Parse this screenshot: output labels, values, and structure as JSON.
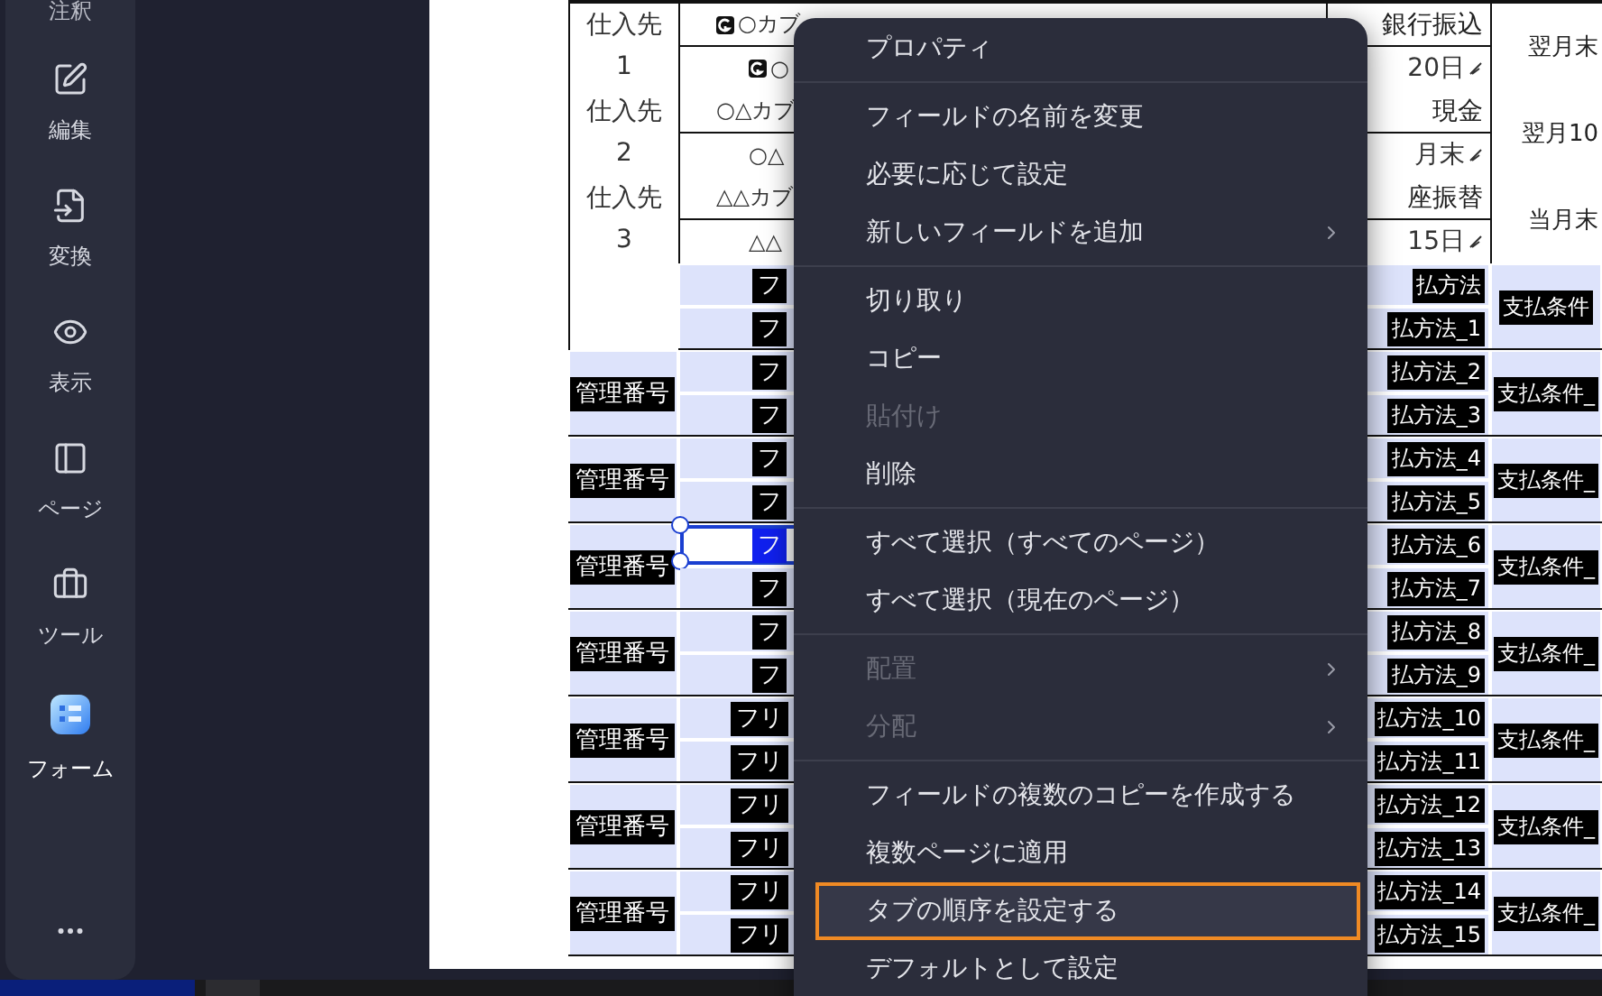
{
  "sidebar": {
    "items": [
      {
        "label": "注釈",
        "kind": "annotate",
        "selected": false
      },
      {
        "label": "編集",
        "kind": "edit",
        "selected": false
      },
      {
        "label": "変換",
        "kind": "convert",
        "selected": false
      },
      {
        "label": "表示",
        "kind": "view",
        "selected": false
      },
      {
        "label": "ページ",
        "kind": "page",
        "selected": false
      },
      {
        "label": "ツール",
        "kind": "tools",
        "selected": false
      },
      {
        "label": "フォーム",
        "kind": "form",
        "selected": true
      }
    ]
  },
  "document": {
    "suppliers": [
      {
        "label": "仕入先",
        "number": "1",
        "names": [
          {
            "text": "○カブ",
            "marked": true
          },
          {
            "text": "○",
            "marked": true
          }
        ],
        "method": "銀行振込",
        "date": "20日",
        "terms": "翌月末"
      },
      {
        "label": "仕入先",
        "number": "2",
        "names": [
          {
            "text": "○△カブ",
            "marked": false
          },
          {
            "text": "○△",
            "marked": false
          }
        ],
        "method": "現金",
        "date": "月末",
        "terms": "翌月10"
      },
      {
        "label": "仕入先",
        "number": "3",
        "names": [
          {
            "text": "△△カブ",
            "marked": false
          },
          {
            "text": "△△",
            "marked": false
          }
        ],
        "method": "座振替",
        "date": "15日",
        "terms": "当月末"
      }
    ],
    "field_groups": [
      {
        "fields": [
          {
            "label": "フ",
            "selected": false
          },
          {
            "label": "フ",
            "selected": false
          }
        ],
        "methods": [
          "払方法",
          "払方法_1"
        ],
        "terms": "支払条件"
      },
      {
        "id_label": "管理番号",
        "fields": [
          {
            "label": "フ",
            "selected": false
          },
          {
            "label": "フ",
            "selected": false
          }
        ],
        "methods": [
          "払方法_2",
          "払方法_3"
        ],
        "terms": "支払条件_"
      },
      {
        "id_label": "管理番号",
        "fields": [
          {
            "label": "フ",
            "selected": false
          },
          {
            "label": "フ",
            "selected": false
          }
        ],
        "methods": [
          "払方法_4",
          "払方法_5"
        ],
        "terms": "支払条件_"
      },
      {
        "id_label": "管理番号",
        "fields": [
          {
            "label": "フ",
            "selected": true
          },
          {
            "label": "フ",
            "selected": false
          }
        ],
        "methods": [
          "払方法_6",
          "払方法_7"
        ],
        "terms": "支払条件_"
      },
      {
        "id_label": "管理番号",
        "fields": [
          {
            "label": "フ",
            "selected": false
          },
          {
            "label": "フ",
            "selected": false
          }
        ],
        "methods": [
          "払方法_8",
          "払方法_9"
        ],
        "terms": "支払条件_"
      },
      {
        "id_label": "管理番号",
        "fields": [
          {
            "label": "フリ",
            "selected": false
          },
          {
            "label": "フリ",
            "selected": false
          }
        ],
        "methods": [
          "払方法_10",
          "払方法_11"
        ],
        "terms": "支払条件_"
      },
      {
        "id_label": "管理番号",
        "fields": [
          {
            "label": "フリ",
            "selected": false
          },
          {
            "label": "フリ",
            "selected": false
          }
        ],
        "methods": [
          "払方法_12",
          "払方法_13"
        ],
        "terms": "支払条件_"
      },
      {
        "id_label": "管理番号",
        "fields": [
          {
            "label": "フリ",
            "selected": false
          },
          {
            "label": "フリ",
            "selected": false
          }
        ],
        "methods": [
          "払方法_14",
          "払方法_15"
        ],
        "terms": "支払条件_"
      }
    ]
  },
  "context_menu": {
    "sections": [
      [
        {
          "label": "プロパティ",
          "disabled": false,
          "submenu": false,
          "highlighted": false
        }
      ],
      [
        {
          "label": "フィールドの名前を変更",
          "disabled": false,
          "submenu": false,
          "highlighted": false
        },
        {
          "label": "必要に応じて設定",
          "disabled": false,
          "submenu": false,
          "highlighted": false
        },
        {
          "label": "新しいフィールドを追加",
          "disabled": false,
          "submenu": true,
          "highlighted": false
        }
      ],
      [
        {
          "label": "切り取り",
          "disabled": false,
          "submenu": false,
          "highlighted": false
        },
        {
          "label": "コピー",
          "disabled": false,
          "submenu": false,
          "highlighted": false
        },
        {
          "label": "貼付け",
          "disabled": true,
          "submenu": false,
          "highlighted": false
        },
        {
          "label": "削除",
          "disabled": false,
          "submenu": false,
          "highlighted": false
        }
      ],
      [
        {
          "label": "すべて選択（すべてのページ）",
          "disabled": false,
          "submenu": false,
          "highlighted": false
        },
        {
          "label": "すべて選択（現在のページ）",
          "disabled": false,
          "submenu": false,
          "highlighted": false
        }
      ],
      [
        {
          "label": "配置",
          "disabled": true,
          "submenu": true,
          "highlighted": false
        },
        {
          "label": "分配",
          "disabled": true,
          "submenu": true,
          "highlighted": false
        }
      ],
      [
        {
          "label": "フィールドの複数のコピーを作成する",
          "disabled": false,
          "submenu": false,
          "highlighted": false
        },
        {
          "label": "複数ページに適用",
          "disabled": false,
          "submenu": false,
          "highlighted": false
        },
        {
          "label": "タブの順序を設定する",
          "disabled": false,
          "submenu": false,
          "highlighted": true
        },
        {
          "label": "デフォルトとして設定",
          "disabled": false,
          "submenu": false,
          "highlighted": false
        }
      ]
    ]
  }
}
